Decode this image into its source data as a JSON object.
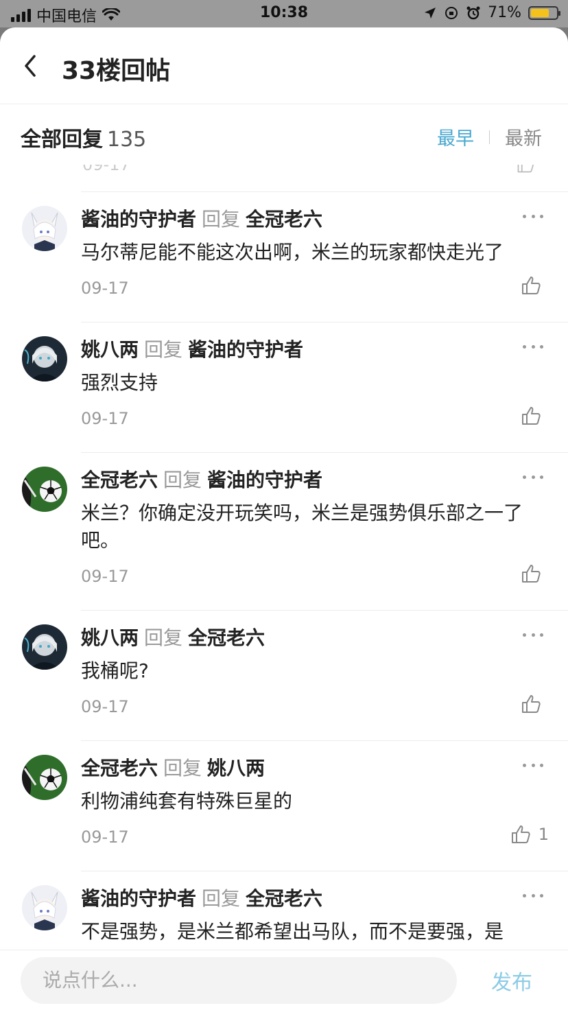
{
  "status_bar": {
    "carrier": "中国电信",
    "time": "10:38",
    "battery_percent": "71%",
    "battery_level": 0.71
  },
  "nav": {
    "title": "33楼回帖"
  },
  "reply_header": {
    "label": "全部回复",
    "count": "135",
    "sort_earliest": "最早",
    "sort_latest": "最新",
    "active_sort": "最早",
    "active_color": "#4aa8cf"
  },
  "comments": [
    {
      "author": "酱油的守护者",
      "reply_word": "回复",
      "target": "全冠老六",
      "text": "马尔蒂尼能不能这次出啊，米兰的玩家都快走光了",
      "date": "09-17",
      "likes": "",
      "avatar": "fox-girl-avatar"
    },
    {
      "author": "姚八两",
      "reply_word": "回复",
      "target": "酱油的守护者",
      "text": "强烈支持",
      "date": "09-17",
      "likes": "",
      "avatar": "dark-character-avatar"
    },
    {
      "author": "全冠老六",
      "reply_word": "回复",
      "target": "酱油的守护者",
      "text": "米兰？你确定没开玩笑吗，米兰是强势俱乐部之一了吧。",
      "date": "09-17",
      "likes": "",
      "avatar": "soccer-ball-avatar"
    },
    {
      "author": "姚八两",
      "reply_word": "回复",
      "target": "全冠老六",
      "text": "我桶呢?",
      "date": "09-17",
      "likes": "",
      "avatar": "dark-character-avatar"
    },
    {
      "author": "全冠老六",
      "reply_word": "回复",
      "target": "姚八两",
      "text": "利物浦纯套有特殊巨星的",
      "date": "09-17",
      "likes": "1",
      "avatar": "soccer-ball-avatar"
    },
    {
      "author": "酱油的守护者",
      "reply_word": "回复",
      "target": "全冠老六",
      "text": "不是强势，是米兰都希望出马队，而不是要强，是",
      "date": "",
      "likes": "",
      "avatar": "fox-girl-avatar"
    }
  ],
  "input": {
    "placeholder": "说点什么...",
    "publish_label": "发布"
  }
}
